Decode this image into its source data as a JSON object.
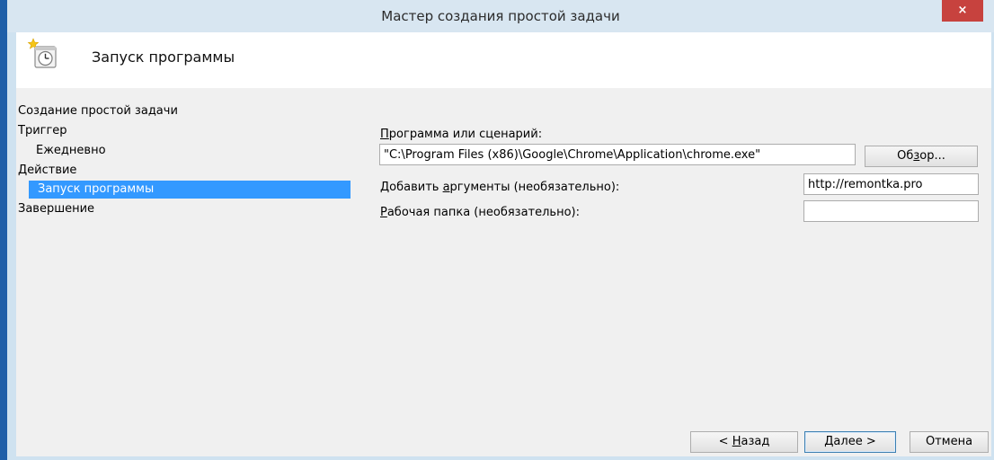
{
  "window": {
    "title": "Мастер создания простой задачи",
    "close_glyph": "×"
  },
  "header": {
    "title": "Запуск программы",
    "icon": "clock-task-icon"
  },
  "sidebar": {
    "items": [
      {
        "label": "Создание простой задачи"
      },
      {
        "label": "Триггер"
      },
      {
        "label": "Ежедневно"
      },
      {
        "label": "Действие"
      },
      {
        "label": "Запуск программы"
      },
      {
        "label": "Завершение"
      }
    ],
    "active_color": "#3399ff"
  },
  "form": {
    "program": {
      "label_key": "П",
      "label_rest": "рограмма или сценарий:",
      "value": "\"C:\\Program Files (x86)\\Google\\Chrome\\Application\\chrome.exe\""
    },
    "browse": {
      "pre": "Об",
      "key": "з",
      "post": "ор..."
    },
    "args": {
      "label_pre": "Добавить ",
      "label_key": "а",
      "label_post": "ргументы (необязательно):",
      "value": "http://remontka.pro"
    },
    "workdir": {
      "label_key": "Р",
      "label_rest": "абочая папка (необязательно):",
      "value": ""
    }
  },
  "footer": {
    "back": {
      "pre": "< ",
      "key": "Н",
      "post": "азад"
    },
    "next": {
      "key": "Д",
      "post": "алее >"
    },
    "cancel": {
      "label": "Отмена"
    }
  }
}
